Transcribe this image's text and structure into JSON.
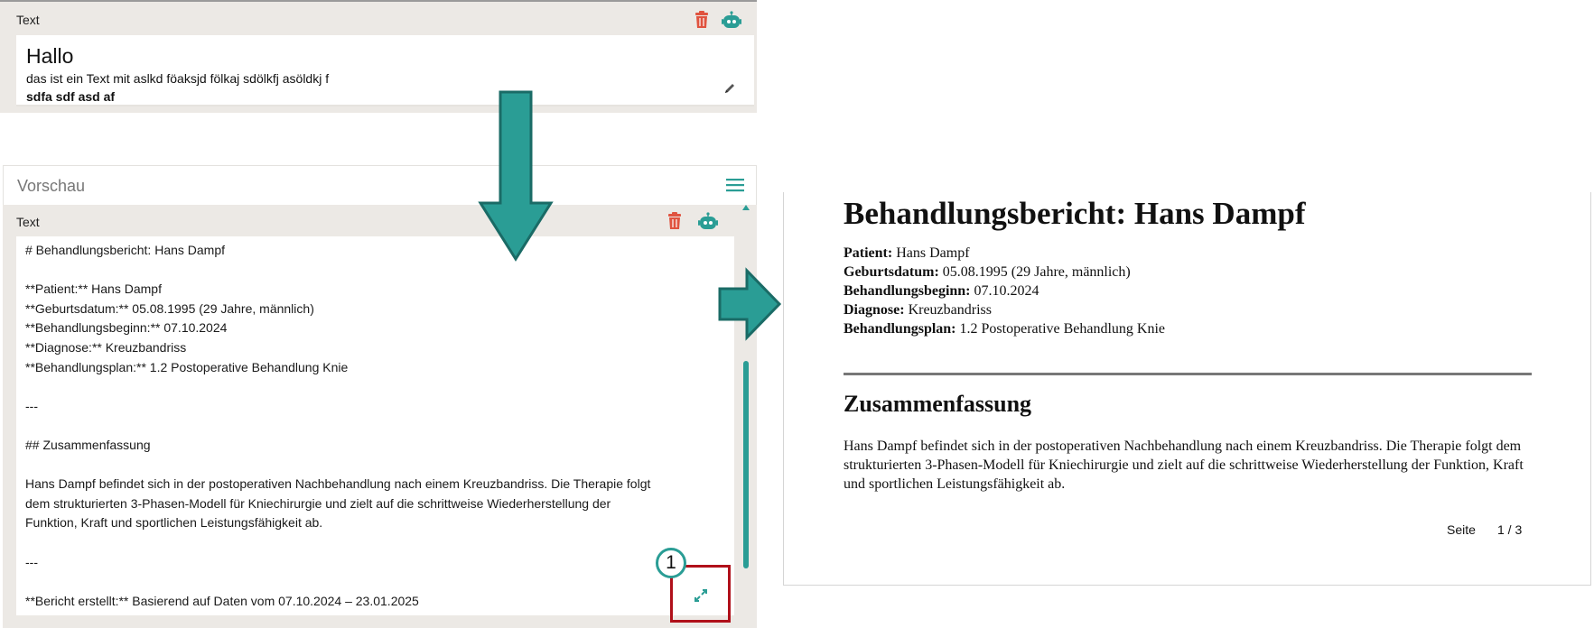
{
  "text_block": {
    "label": "Text",
    "heading": "Hallo",
    "line1": "das ist ein Text mit aslkd föaksjd fölkaj sdölkfj asöldkj f",
    "line2": "sdfa sdf asd af",
    "icons": [
      "trash-icon",
      "robot-icon",
      "pencil-icon"
    ]
  },
  "preview": {
    "title": "Vorschau",
    "text_label": "Text",
    "editor_lines": [
      "# Behandlungsbericht: Hans Dampf",
      "",
      "**Patient:** Hans Dampf",
      "**Geburtsdatum:** 05.08.1995 (29 Jahre, männlich)",
      "**Behandlungsbeginn:** 07.10.2024",
      "**Diagnose:** Kreuzbandriss",
      "**Behandlungsplan:** 1.2 Postoperative Behandlung Knie",
      "",
      "---",
      "",
      "## Zusammenfassung",
      "",
      "Hans Dampf befindet sich in der postoperativen Nachbehandlung nach einem Kreuzbandriss. Die Therapie folgt",
      "dem strukturierten 3-Phasen-Modell für Kniechirurgie und zielt auf die schrittweise Wiederherstellung der",
      "Funktion, Kraft und sportlichen Leistungsfähigkeit ab.",
      "",
      "---",
      "",
      "**Bericht erstellt:** Basierend auf Daten vom 07.10.2024 – 23.01.2025"
    ],
    "callout_number": "1"
  },
  "report": {
    "title": "Behandlungsbericht: Hans Dampf",
    "fields": [
      {
        "label": "Patient:",
        "value": "Hans Dampf"
      },
      {
        "label": "Geburtsdatum:",
        "value": "05.08.1995 (29 Jahre, männlich)"
      },
      {
        "label": "Behandlungsbeginn:",
        "value": "07.10.2024"
      },
      {
        "label": "Diagnose:",
        "value": "Kreuzbandriss"
      },
      {
        "label": "Behandlungsplan:",
        "value": "1.2 Postoperative Behandlung Knie"
      }
    ],
    "summary_heading": "Zusammenfassung",
    "summary_text": "Hans Dampf befindet sich in der postoperativen Nachbehandlung nach einem Kreuzbandriss. Die Therapie folgt dem strukturierten 3-Phasen-Modell für Kniechirurgie und zielt auf die schrittweise Wiederherstellung der Funktion, Kraft und sportlichen Leistungsfähigkeit ab.",
    "page_label": "Seite",
    "page_value": "1 / 3"
  },
  "colors": {
    "accent": "#2a9d95",
    "trash": "#e0533f",
    "highlight": "#b0101a",
    "panel_bg": "#ece9e5"
  }
}
